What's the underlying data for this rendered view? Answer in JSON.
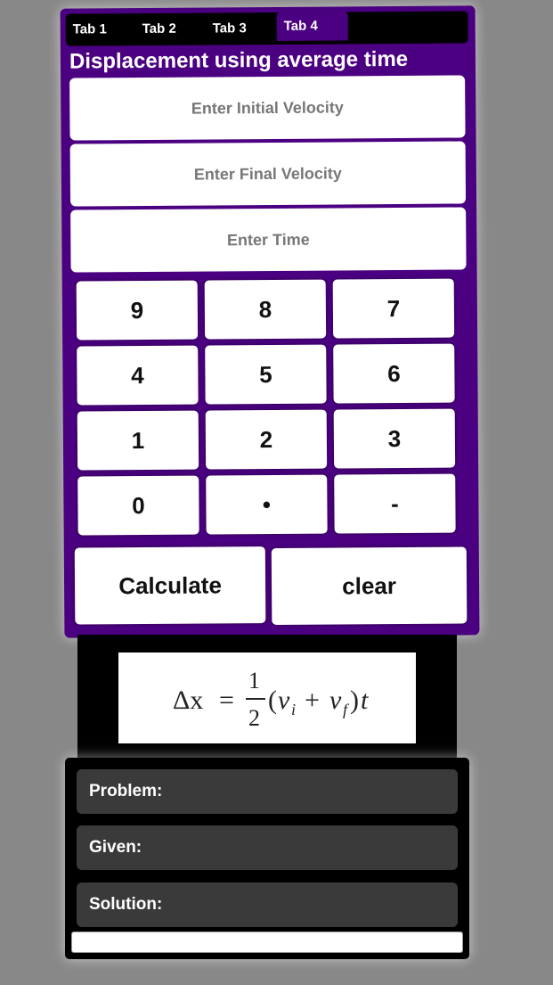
{
  "tabs": [
    {
      "label": "Tab 1"
    },
    {
      "label": "Tab 2"
    },
    {
      "label": "Tab 3"
    },
    {
      "label": "Tab 4",
      "active": true
    }
  ],
  "heading": "Displacement using average time",
  "inputs": {
    "initial_velocity_placeholder": "Enter Initial Velocity",
    "final_velocity_placeholder": "Enter Final Velocity",
    "time_placeholder": "Enter Time"
  },
  "keypad": {
    "rows": [
      [
        "9",
        "8",
        "7"
      ],
      [
        "4",
        "5",
        "6"
      ],
      [
        "1",
        "2",
        "3"
      ],
      [
        "0",
        "•",
        "-"
      ]
    ]
  },
  "actions": {
    "calculate_label": "Calculate",
    "clear_label": "clear"
  },
  "formula": {
    "lhs": "Δx",
    "eq": "=",
    "frac_num": "1",
    "frac_den": "2",
    "open": "(",
    "vi": "v",
    "vi_sub": "i",
    "plus": "+",
    "vf": "v",
    "vf_sub": "f",
    "close": ")",
    "t": "t"
  },
  "result": {
    "problem_label": "Problem:",
    "given_label": "Given:",
    "solution_label": "Solution:"
  },
  "colors": {
    "panel": "#4b0082",
    "background": "#888888",
    "result_row": "#3a3a3a"
  }
}
